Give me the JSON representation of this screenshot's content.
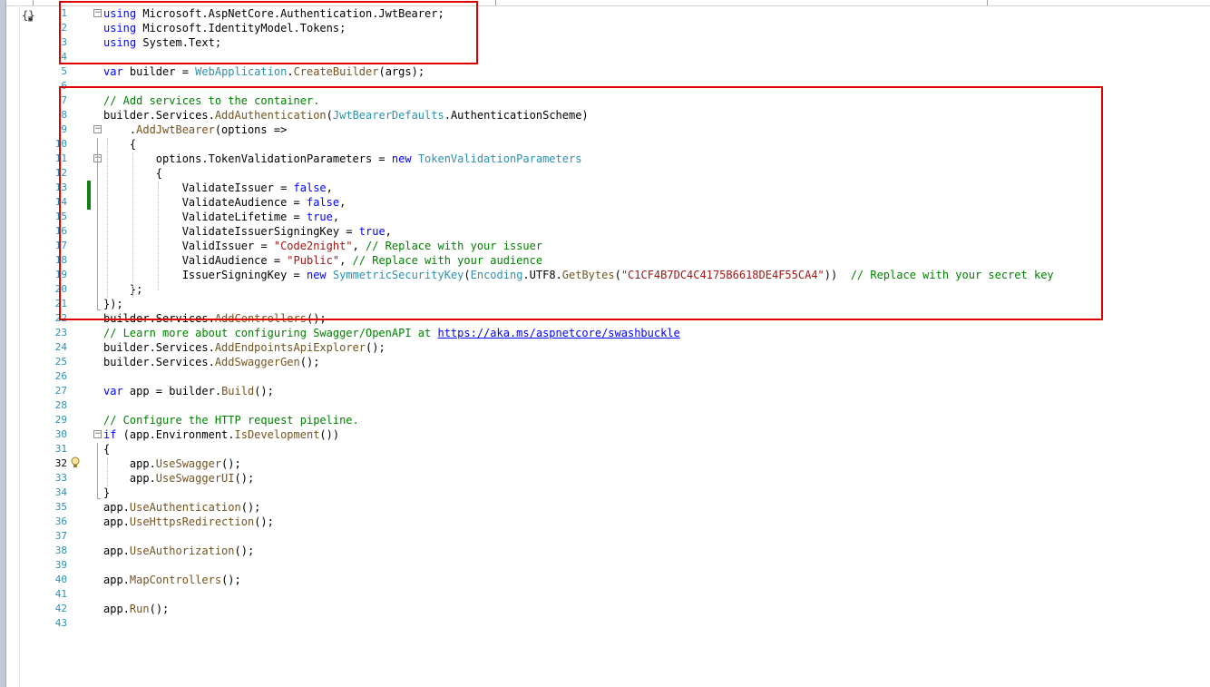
{
  "editor": {
    "active_line": "32",
    "lines": [
      {
        "n": "1",
        "tokens": [
          [
            "k",
            "using"
          ],
          [
            "p",
            " Microsoft.AspNetCore.Authentication.JwtBearer;"
          ]
        ]
      },
      {
        "n": "2",
        "tokens": [
          [
            "k",
            "using"
          ],
          [
            "p",
            " Microsoft.IdentityModel.Tokens;"
          ]
        ]
      },
      {
        "n": "3",
        "tokens": [
          [
            "k",
            "using"
          ],
          [
            "p",
            " System.Text;"
          ]
        ]
      },
      {
        "n": "4",
        "tokens": []
      },
      {
        "n": "5",
        "tokens": [
          [
            "k",
            "var"
          ],
          [
            "p",
            " builder = "
          ],
          [
            "t",
            "WebApplication"
          ],
          [
            "p",
            "."
          ],
          [
            "m",
            "CreateBuilder"
          ],
          [
            "p",
            "(args);"
          ]
        ]
      },
      {
        "n": "6",
        "tokens": []
      },
      {
        "n": "7",
        "tokens": [
          [
            "c",
            "// Add services to the container."
          ]
        ]
      },
      {
        "n": "8",
        "tokens": [
          [
            "p",
            "builder.Services."
          ],
          [
            "m",
            "AddAuthentication"
          ],
          [
            "p",
            "("
          ],
          [
            "t",
            "JwtBearerDefaults"
          ],
          [
            "p",
            ".AuthenticationScheme)"
          ]
        ]
      },
      {
        "n": "9",
        "tokens": [
          [
            "p",
            "    ."
          ],
          [
            "m",
            "AddJwtBearer"
          ],
          [
            "p",
            "(options =>"
          ]
        ]
      },
      {
        "n": "10",
        "tokens": [
          [
            "p",
            "    {"
          ]
        ]
      },
      {
        "n": "11",
        "tokens": [
          [
            "p",
            "        options.TokenValidationParameters = "
          ],
          [
            "k",
            "new"
          ],
          [
            "p",
            " "
          ],
          [
            "t",
            "TokenValidationParameters"
          ]
        ]
      },
      {
        "n": "12",
        "tokens": [
          [
            "p",
            "        {"
          ]
        ]
      },
      {
        "n": "13",
        "tokens": [
          [
            "p",
            "            ValidateIssuer = "
          ],
          [
            "k",
            "false"
          ],
          [
            "p",
            ","
          ]
        ]
      },
      {
        "n": "14",
        "tokens": [
          [
            "p",
            "            ValidateAudience = "
          ],
          [
            "k",
            "false"
          ],
          [
            "p",
            ","
          ]
        ]
      },
      {
        "n": "15",
        "tokens": [
          [
            "p",
            "            ValidateLifetime = "
          ],
          [
            "k",
            "true"
          ],
          [
            "p",
            ","
          ]
        ]
      },
      {
        "n": "16",
        "tokens": [
          [
            "p",
            "            ValidateIssuerSigningKey = "
          ],
          [
            "k",
            "true"
          ],
          [
            "p",
            ","
          ]
        ]
      },
      {
        "n": "17",
        "tokens": [
          [
            "p",
            "            ValidIssuer = "
          ],
          [
            "s",
            "\"Code2night\""
          ],
          [
            "p",
            ", "
          ],
          [
            "c",
            "// Replace with your issuer"
          ]
        ]
      },
      {
        "n": "18",
        "tokens": [
          [
            "p",
            "            ValidAudience = "
          ],
          [
            "s",
            "\"Public\""
          ],
          [
            "p",
            ", "
          ],
          [
            "c",
            "// Replace with your audience"
          ]
        ]
      },
      {
        "n": "19",
        "tokens": [
          [
            "p",
            "            IssuerSigningKey = "
          ],
          [
            "k",
            "new"
          ],
          [
            "p",
            " "
          ],
          [
            "t",
            "SymmetricSecurityKey"
          ],
          [
            "p",
            "("
          ],
          [
            "t",
            "Encoding"
          ],
          [
            "p",
            ".UTF8."
          ],
          [
            "m",
            "GetBytes"
          ],
          [
            "p",
            "("
          ],
          [
            "s",
            "\"C1CF4B7DC4C4175B6618DE4F55CA4\""
          ],
          [
            "p",
            "))  "
          ],
          [
            "c",
            "// Replace with your secret key"
          ]
        ]
      },
      {
        "n": "20",
        "tokens": [
          [
            "p",
            "    };"
          ]
        ]
      },
      {
        "n": "21",
        "tokens": [
          [
            "p",
            "});"
          ]
        ]
      },
      {
        "n": "22",
        "tokens": [
          [
            "p",
            "builder.Services."
          ],
          [
            "m",
            "AddControllers"
          ],
          [
            "p",
            "();"
          ]
        ]
      },
      {
        "n": "23",
        "tokens": [
          [
            "c",
            "// Learn more about configuring Swagger/OpenAPI at "
          ],
          [
            "u",
            "https://aka.ms/aspnetcore/swashbuckle"
          ]
        ]
      },
      {
        "n": "24",
        "tokens": [
          [
            "p",
            "builder.Services."
          ],
          [
            "m",
            "AddEndpointsApiExplorer"
          ],
          [
            "p",
            "();"
          ]
        ]
      },
      {
        "n": "25",
        "tokens": [
          [
            "p",
            "builder.Services."
          ],
          [
            "m",
            "AddSwaggerGen"
          ],
          [
            "p",
            "();"
          ]
        ]
      },
      {
        "n": "26",
        "tokens": []
      },
      {
        "n": "27",
        "tokens": [
          [
            "k",
            "var"
          ],
          [
            "p",
            " app = builder."
          ],
          [
            "m",
            "Build"
          ],
          [
            "p",
            "();"
          ]
        ]
      },
      {
        "n": "28",
        "tokens": []
      },
      {
        "n": "29",
        "tokens": [
          [
            "c",
            "// Configure the HTTP request pipeline."
          ]
        ]
      },
      {
        "n": "30",
        "tokens": [
          [
            "k",
            "if"
          ],
          [
            "p",
            " (app.Environment."
          ],
          [
            "m",
            "IsDevelopment"
          ],
          [
            "p",
            "())"
          ]
        ]
      },
      {
        "n": "31",
        "tokens": [
          [
            "p",
            "{"
          ]
        ]
      },
      {
        "n": "32",
        "tokens": [
          [
            "p",
            "    app."
          ],
          [
            "m",
            "UseSwagger"
          ],
          [
            "p",
            "();"
          ]
        ]
      },
      {
        "n": "33",
        "tokens": [
          [
            "p",
            "    app."
          ],
          [
            "m",
            "UseSwaggerUI"
          ],
          [
            "p",
            "();"
          ]
        ]
      },
      {
        "n": "34",
        "tokens": [
          [
            "p",
            "}"
          ]
        ]
      },
      {
        "n": "35",
        "tokens": [
          [
            "p",
            "app."
          ],
          [
            "m",
            "UseAuthentication"
          ],
          [
            "p",
            "();"
          ]
        ]
      },
      {
        "n": "36",
        "tokens": [
          [
            "p",
            "app."
          ],
          [
            "m",
            "UseHttpsRedirection"
          ],
          [
            "p",
            "();"
          ]
        ]
      },
      {
        "n": "37",
        "tokens": []
      },
      {
        "n": "38",
        "tokens": [
          [
            "p",
            "app."
          ],
          [
            "m",
            "UseAuthorization"
          ],
          [
            "p",
            "();"
          ]
        ]
      },
      {
        "n": "39",
        "tokens": []
      },
      {
        "n": "40",
        "tokens": [
          [
            "p",
            "app."
          ],
          [
            "m",
            "MapControllers"
          ],
          [
            "p",
            "();"
          ]
        ]
      },
      {
        "n": "41",
        "tokens": []
      },
      {
        "n": "42",
        "tokens": [
          [
            "p",
            "app."
          ],
          [
            "m",
            "Run"
          ],
          [
            "p",
            "();"
          ]
        ]
      },
      {
        "n": "43",
        "tokens": []
      }
    ]
  },
  "colors": {
    "keyword": "#0000ff",
    "type": "#2b91af",
    "method": "#74531f",
    "string": "#a31515",
    "comment": "#008000",
    "line_number": "#2b91af",
    "change_bar": "#108010",
    "highlight_box": "#e00000"
  },
  "icons": {
    "navigation_bar": "code-navigation-icon",
    "quick_actions": "lightbulb-icon",
    "outline_collapse": "collapse-minus-icon"
  }
}
